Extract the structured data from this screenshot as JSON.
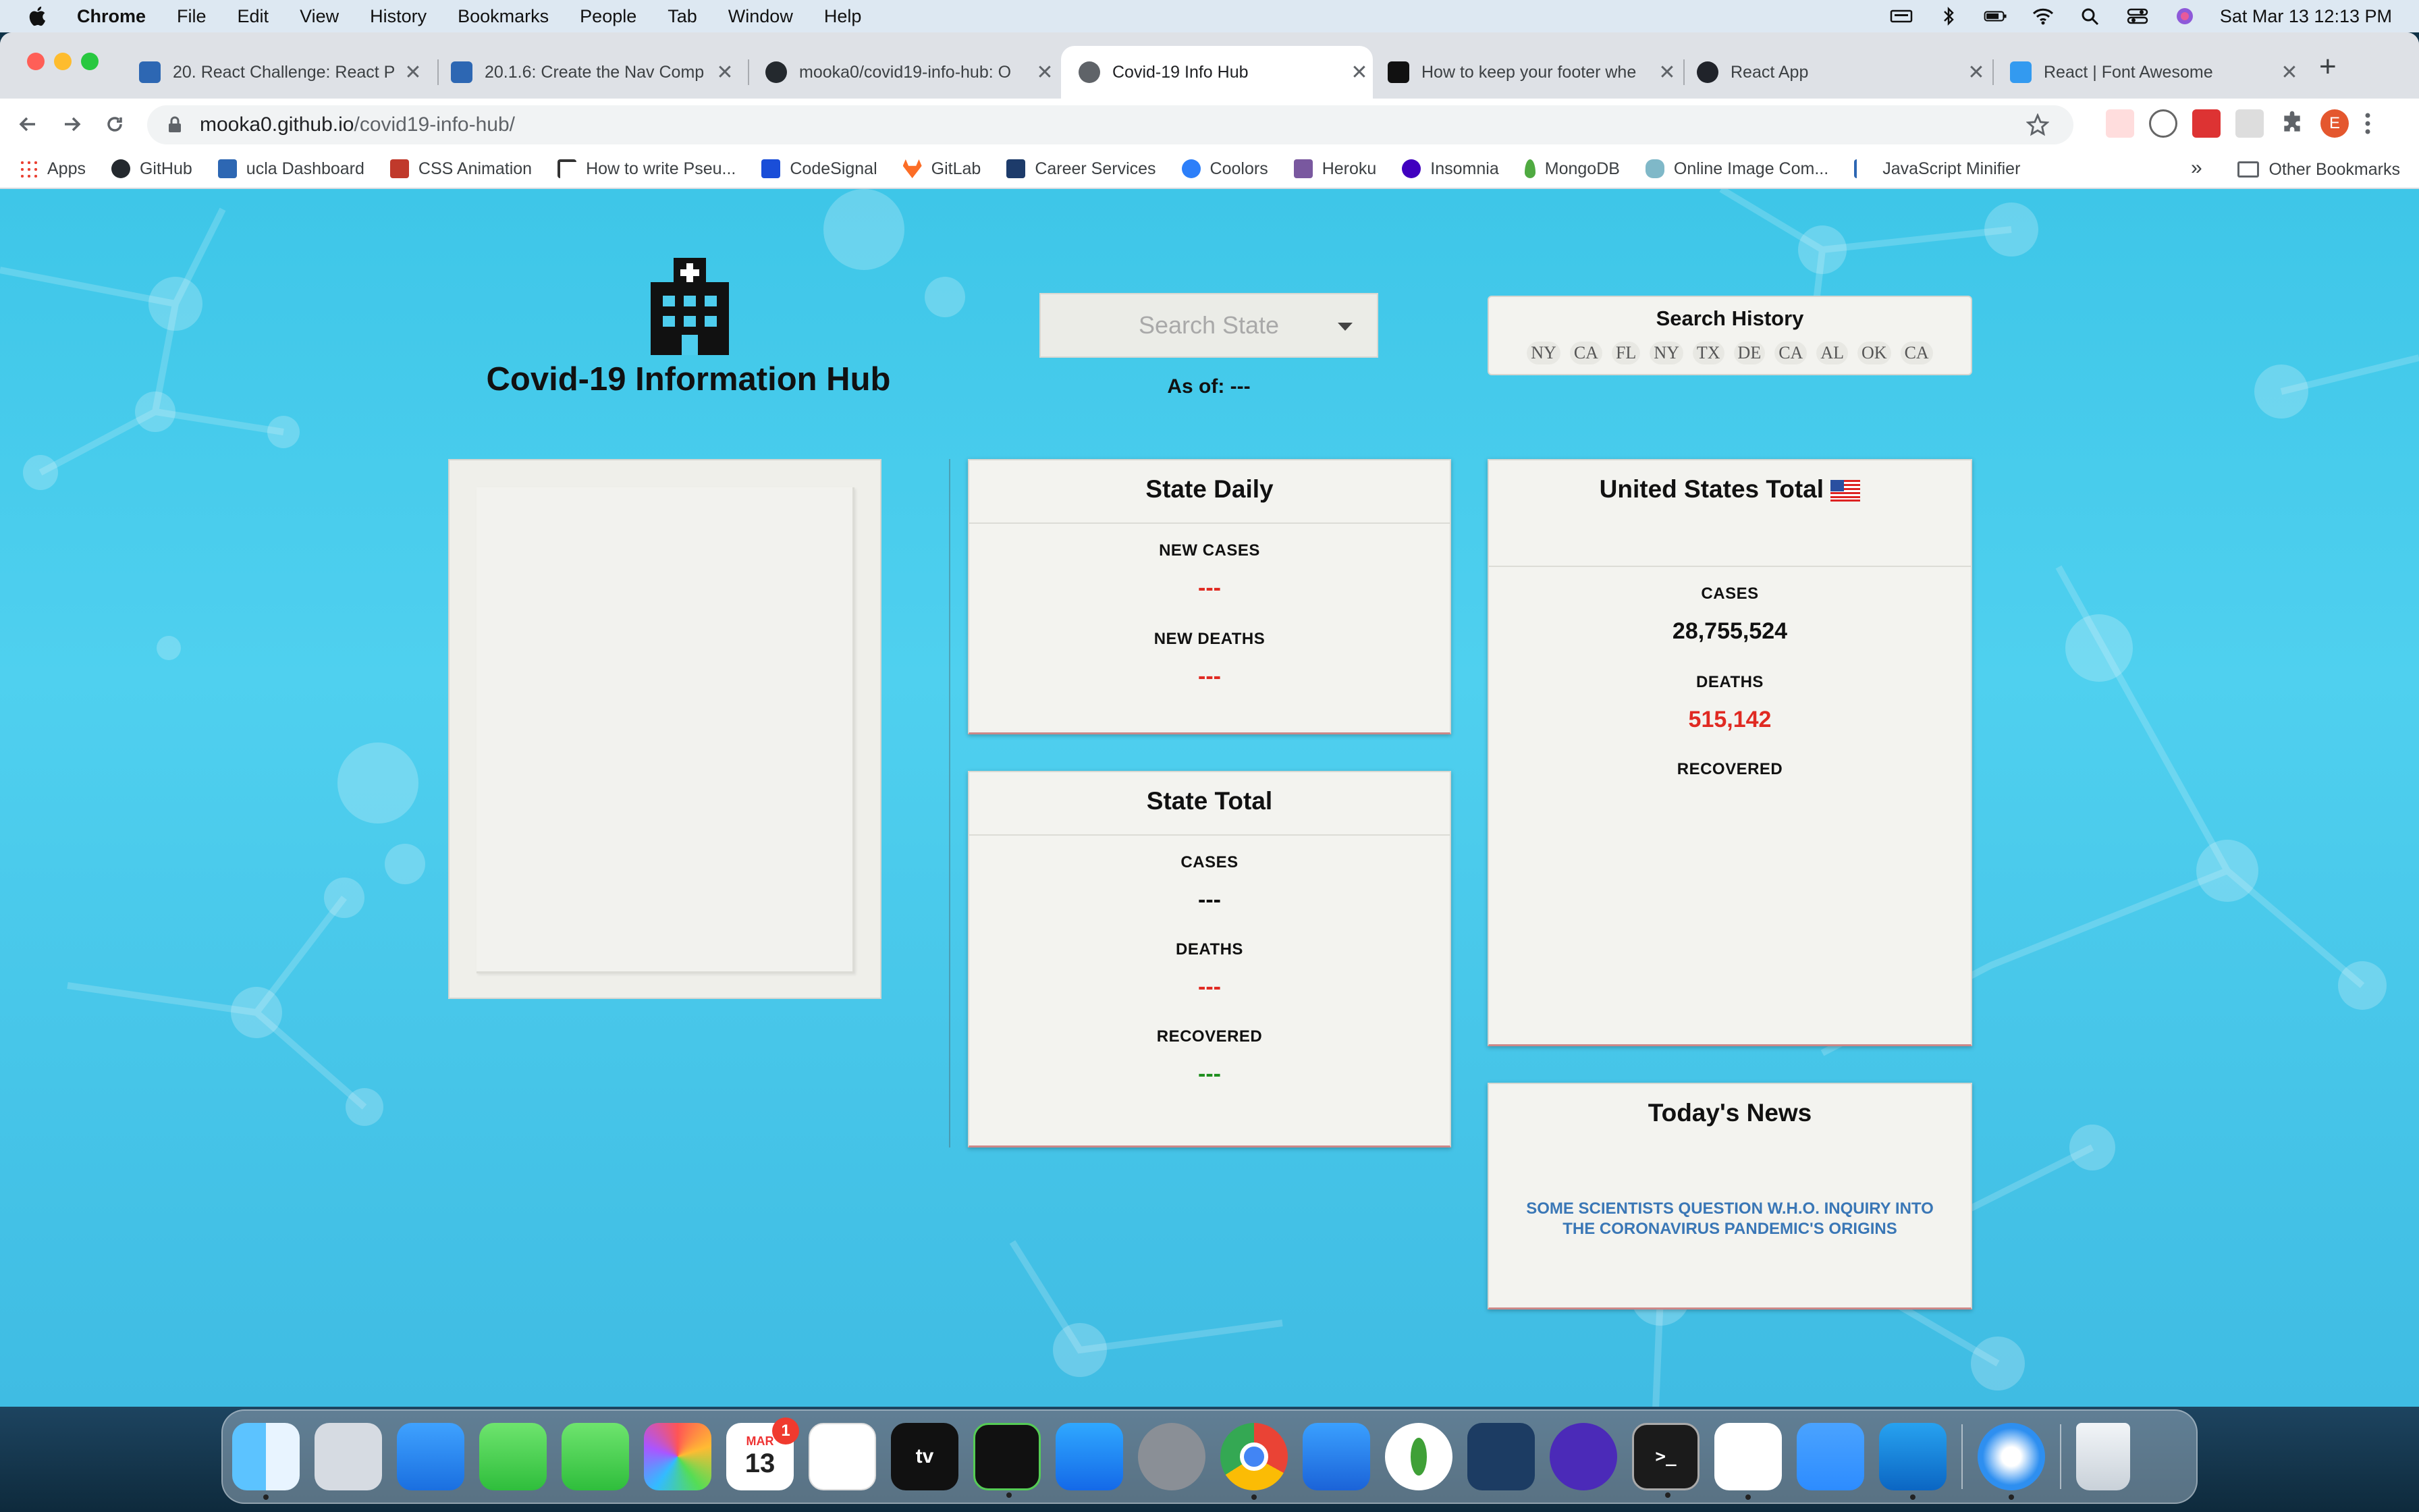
{
  "menubar": {
    "app": "Chrome",
    "items": [
      "File",
      "Edit",
      "View",
      "History",
      "Bookmarks",
      "People",
      "Tab",
      "Window",
      "Help"
    ],
    "clock": "Sat Mar 13  12:13 PM"
  },
  "tabs": [
    {
      "title": "20. React Challenge: React P",
      "active": false
    },
    {
      "title": "20.1.6: Create the Nav Comp",
      "active": false
    },
    {
      "title": "mooka0/covid19-info-hub: O",
      "active": false
    },
    {
      "title": "Covid-19 Info Hub",
      "active": true
    },
    {
      "title": "How to keep your footer whe",
      "active": false
    },
    {
      "title": "React App",
      "active": false
    },
    {
      "title": "React | Font Awesome",
      "active": false
    }
  ],
  "address": {
    "host": "mooka0.github.io",
    "path": "/covid19-info-hub/"
  },
  "bookmarks": [
    "Apps",
    "GitHub",
    "ucla Dashboard",
    "CSS Animation",
    "How to write Pseu...",
    "CodeSignal",
    "GitLab",
    "Career Services",
    "Coolors",
    "Heroku",
    "Insomnia",
    "MongoDB",
    "Online Image Com...",
    "JavaScript Minifier"
  ],
  "bookmarks_more": "»",
  "bookmarks_other": "Other Bookmarks",
  "profile_initial": "E",
  "hub": {
    "title": "Covid-19 Information Hub",
    "search_placeholder": "Search State",
    "as_of": "As of: ---",
    "history_title": "Search History",
    "history": [
      "NY",
      "CA",
      "FL",
      "NY",
      "TX",
      "DE",
      "CA",
      "AL",
      "OK",
      "CA"
    ]
  },
  "state_daily": {
    "title": "State Daily",
    "new_cases_label": "NEW CASES",
    "new_cases": "---",
    "new_deaths_label": "NEW DEATHS",
    "new_deaths": "---"
  },
  "state_total": {
    "title": "State Total",
    "cases_label": "CASES",
    "cases": "---",
    "deaths_label": "DEATHS",
    "deaths": "---",
    "recovered_label": "RECOVERED",
    "recovered": "---"
  },
  "us_total": {
    "title": "United States Total",
    "cases_label": "CASES",
    "cases": "28,755,524",
    "deaths_label": "DEATHS",
    "deaths": "515,142",
    "recovered_label": "RECOVERED"
  },
  "news": {
    "title": "Today's News",
    "headline": "SOME SCIENTISTS QUESTION W.H.O. INQUIRY INTO THE CORONAVIRUS PANDEMIC'S ORIGINS"
  },
  "dock": {
    "calendar_month": "MAR",
    "calendar_day": "13",
    "calendar_badge": "1",
    "appletv_label": "tv"
  },
  "colors": {
    "accent_red": "#e02a22",
    "accent_green": "#1f8f1f",
    "news_link": "#3a77b6",
    "page_bg": "#3ec6e8"
  }
}
